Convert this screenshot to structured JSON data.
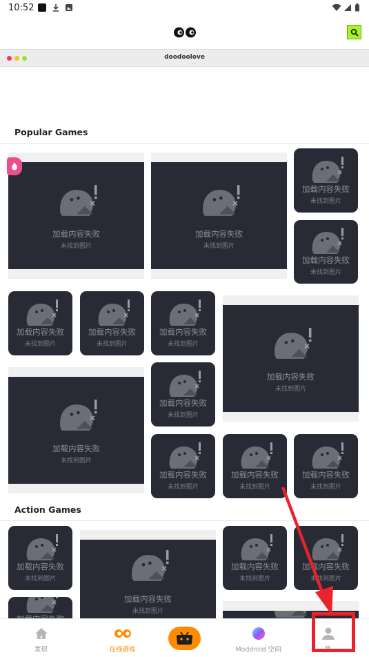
{
  "status_bar": {
    "time": "10:52"
  },
  "app_bar": {
    "logo_icon": "eyes-logo-icon",
    "search_icon": "search-icon"
  },
  "browser_bar": {
    "url": "doodoolove"
  },
  "sections": {
    "popular": {
      "title": "Popular Games"
    },
    "action": {
      "title": "Action Games"
    }
  },
  "tile_text": {
    "fail": "加载内容失败",
    "not_found": "未找到图片"
  },
  "tabs": [
    {
      "label": "发现",
      "icon": "home-icon"
    },
    {
      "label": "在线游戏",
      "icon": "eyes-icon"
    },
    {
      "label": "",
      "icon": "gamepad-icon"
    },
    {
      "label": "Moddroid 空间",
      "icon": "planet-icon"
    },
    {
      "label": "我",
      "icon": "user-icon"
    }
  ],
  "colors": {
    "accent": "#ff8a00",
    "search_bg": "#a8f22e",
    "tile_bg": "#282b36",
    "annotation": "#e8232b"
  }
}
